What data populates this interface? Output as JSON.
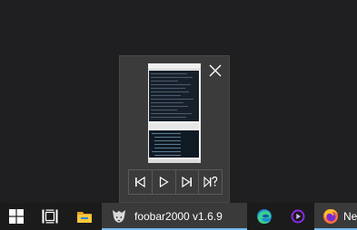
{
  "taskbar": {
    "active_app_label": "foobar2000 v1.6.9",
    "truncated_app_label": "New"
  },
  "preview": {
    "controls": [
      "previous-track",
      "play",
      "next-track",
      "random"
    ]
  },
  "icons": {
    "start": "windows-logo-icon",
    "task_view": "task-view-icon",
    "explorer": "file-explorer-icon",
    "foobar": "foobar2000-icon",
    "edge": "edge-icon",
    "media": "media-player-icon",
    "firefox": "firefox-icon"
  },
  "colors": {
    "taskbar_bg": "#1b1b1b",
    "active_bg": "#3a3a3a",
    "active_underline": "#76b9ed",
    "preview_bg": "#3b3b3b"
  }
}
